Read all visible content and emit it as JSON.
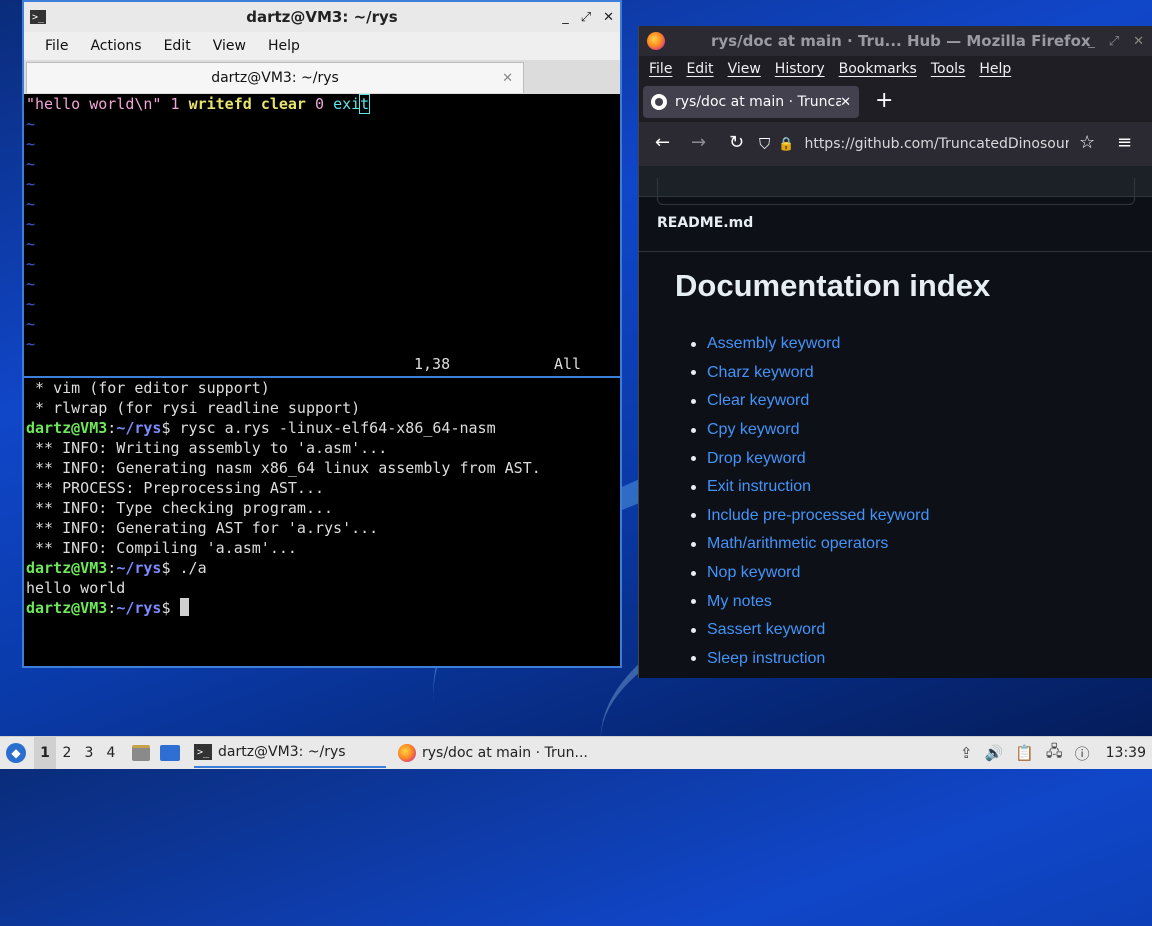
{
  "terminal": {
    "window_title": "dartz@VM3: ~/rys",
    "app_icon": "terminal-icon",
    "controls": [
      "_",
      "⤢",
      "✕"
    ],
    "menu": [
      "File",
      "Actions",
      "Edit",
      "View",
      "Help"
    ],
    "tab_title": "dartz@VM3: ~/rys",
    "tab_close": "✕",
    "vim": {
      "code": {
        "str": "\"hello world\\n\"",
        "num1": "1",
        "kw1": "writefd",
        "kw2": "clear",
        "num2": "0",
        "ex1": "exi",
        "ex2": "t"
      },
      "tilde": "~",
      "position": "1,38",
      "scroll": "All"
    },
    "shell": {
      "lines": [
        " * vim (for editor support)",
        " * rlwrap (for rysi readline support)"
      ],
      "prompt_user": "dartz@VM3",
      "prompt_sep": ":",
      "prompt_path": "~/rys",
      "prompt_dollar": "$ ",
      "cmd1": "rysc a.rys -linux-elf64-x86_64-nasm",
      "output1": [
        " ** INFO: Writing assembly to 'a.asm'...",
        " ** INFO: Generating nasm x86_64 linux assembly from AST.",
        " ** PROCESS: Preprocessing AST...",
        " ** INFO: Type checking program...",
        " ** INFO: Generating AST for 'a.rys'...",
        " ** INFO: Compiling 'a.asm'..."
      ],
      "cmd2": "./a",
      "output2": "hello world"
    }
  },
  "firefox": {
    "window_title": "rys/doc at main · Tru... Hub — Mozilla Firefox",
    "controls": [
      "_",
      "⤢",
      "✕"
    ],
    "menu": [
      "File",
      "Edit",
      "View",
      "History",
      "Bookmarks",
      "Tools",
      "Help"
    ],
    "tab_label": "rys/doc at main · TruncatedDinosour",
    "tab_close": "✕",
    "new_tab": "+",
    "nav": {
      "back": "←",
      "forward": "→",
      "reload": "↻",
      "shield": "⛉",
      "lock": "🔒",
      "menu": "≡",
      "star": "☆"
    },
    "url": "https://github.com/TruncatedDinosour/rys",
    "readme_file": "README.md",
    "doc_heading": "Documentation index",
    "doc_links": [
      "Assembly keyword",
      "Charz keyword",
      "Clear keyword",
      "Cpy keyword",
      "Drop keyword",
      "Exit instruction",
      "Include pre-processed keyword",
      "Math/arithmetic operators",
      "Nop keyword",
      "My notes",
      "Sassert keyword",
      "Sleep instruction"
    ],
    "colors": {
      "link": "#4493f8",
      "page_bg": "#0d1117"
    }
  },
  "taskbar": {
    "workspaces": [
      "1",
      "2",
      "3",
      "4"
    ],
    "tasks": [
      {
        "label": "dartz@VM3: ~/rys",
        "icon": "terminal-icon"
      },
      {
        "label": "rys/doc at main · Trun...",
        "icon": "firefox-icon"
      }
    ],
    "tray_icons": [
      "update-icon",
      "volume-icon",
      "clipboard-icon",
      "network-icon",
      "notification-icon"
    ],
    "clock": "13:39"
  }
}
